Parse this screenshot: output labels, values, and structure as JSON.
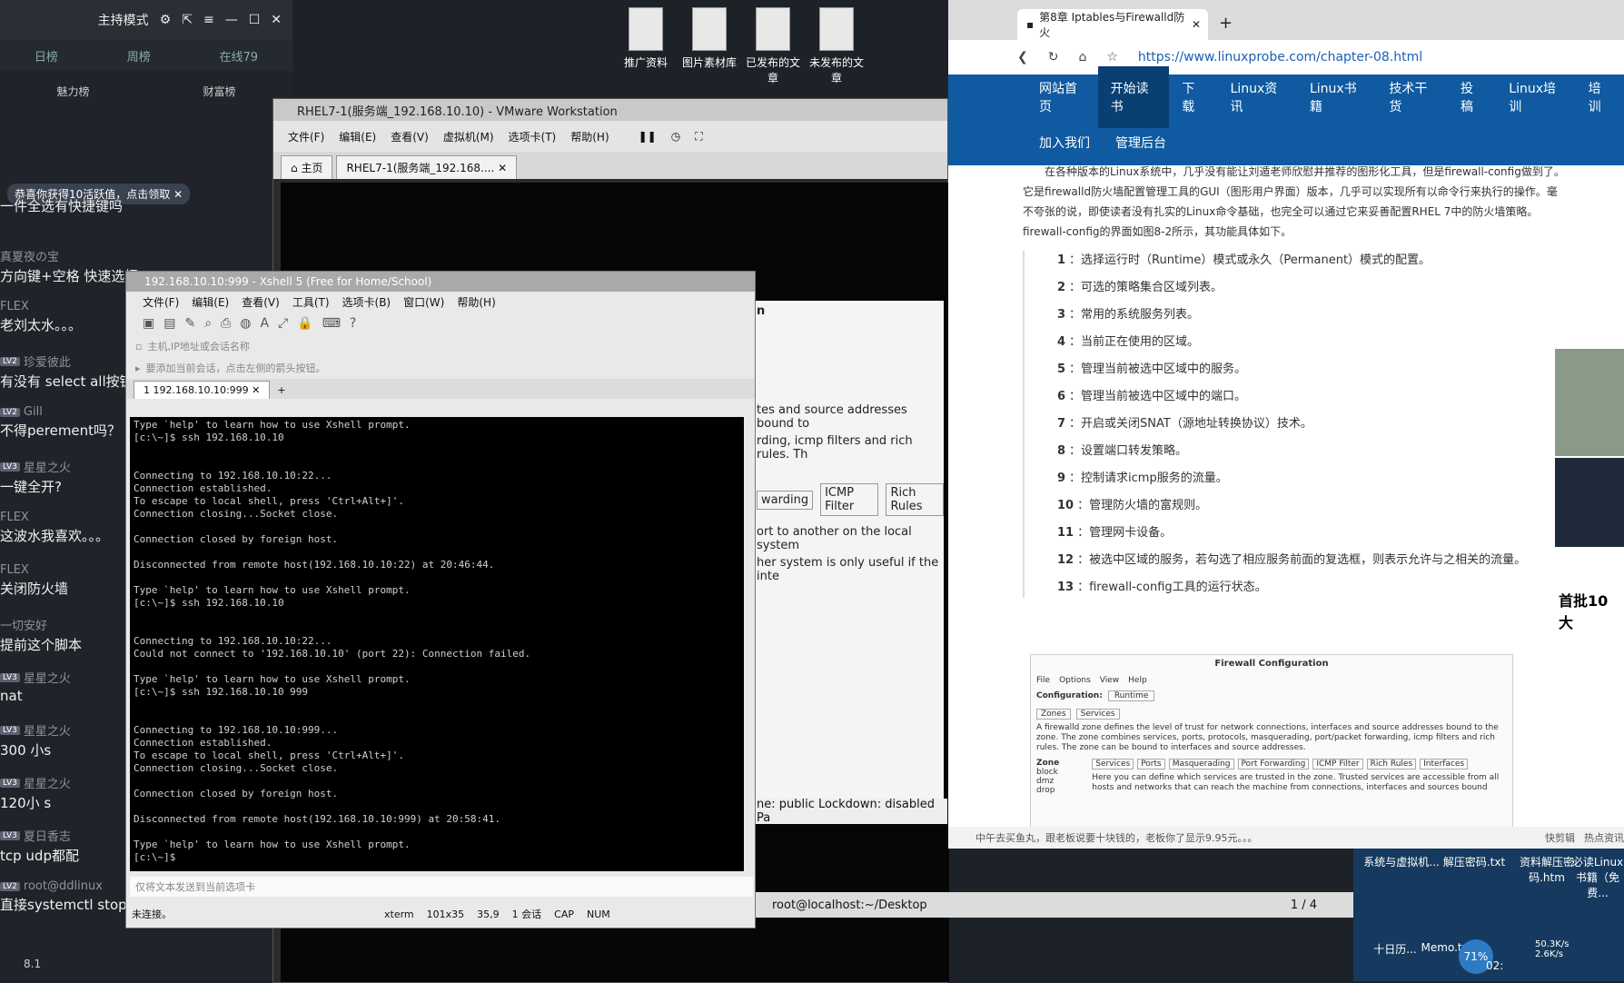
{
  "chat": {
    "window_title": "主持模式",
    "tabs": [
      "日榜",
      "周榜",
      "在线79"
    ],
    "ranks": [
      "魅力榜",
      "财富榜"
    ],
    "notice": "恭喜你获得10活跃值，点击领取",
    "messages": [
      {
        "user": "",
        "level": "",
        "text": "一件全选有快捷键吗"
      },
      {
        "user": "真夏夜の宝",
        "level": "",
        "text": "方向键+空格 快速选择"
      },
      {
        "user": "FLEX",
        "level": "",
        "text": "老刘太水。。。"
      },
      {
        "user": "珍爱彼此",
        "level": "LV2",
        "text": "有没有 select all按钮"
      },
      {
        "user": "Gill",
        "level": "LV2",
        "text": "不得perement吗？"
      },
      {
        "user": "星星之火",
        "level": "LV3",
        "text": "一键全开?"
      },
      {
        "user": "FLEX",
        "level": "",
        "text": "这波水我喜欢。。。"
      },
      {
        "user": "FLEX",
        "level": "",
        "text": "关闭防火墙"
      },
      {
        "user": "一切安好",
        "level": "",
        "text": "提前这个脚本"
      },
      {
        "user": "星星之火",
        "level": "LV3",
        "text": "nat"
      },
      {
        "user": "星星之火",
        "level": "LV3",
        "text": "300  小s"
      },
      {
        "user": "星星之火",
        "level": "LV3",
        "text": "120小 s"
      },
      {
        "user": "夏日香志",
        "level": "LV3",
        "text": "tcp udp都配"
      },
      {
        "user": "root@ddlinux",
        "level": "LV2",
        "text": "直接systemctl stop"
      }
    ],
    "bottom_value": "8.1"
  },
  "desktop": {
    "icons": [
      "推广资料",
      "图片素材库",
      "已发布的文章",
      "未发布的文章"
    ]
  },
  "vmware": {
    "title": "RHEL7-1(服务端_192.168.10.10) - VMware Workstation",
    "menu": [
      "文件(F)",
      "编辑(E)",
      "查看(V)",
      "虚拟机(M)",
      "选项卡(T)",
      "帮助(H)"
    ],
    "tabs": [
      "主页",
      "RHEL7-1(服务端_192.168...."
    ],
    "guest": {
      "frag_n": "n",
      "frag1": "tes and source addresses bound to",
      "frag2": "rding, icmp filters and rich rules. Th",
      "fw_tabs": [
        "warding",
        "ICMP Filter",
        "Rich Rules"
      ],
      "frag3": "ort to another on the local system",
      "frag4": "her system is only useful if the inte",
      "status": "ne: public  Lockdown: disabled  Pa"
    },
    "terminal_strip": {
      "title": "root@localhost:~/Desktop",
      "page": "1 / 4"
    }
  },
  "xshell": {
    "title": "192.168.10.10:999 - Xshell 5 (Free for Home/School)",
    "menu": [
      "文件(F)",
      "编辑(E)",
      "查看(V)",
      "工具(T)",
      "选项卡(B)",
      "窗口(W)",
      "帮助(H)"
    ],
    "address_placeholder": "主机,IP地址或会话名称",
    "hint": "要添加当前会话，点击左侧的箭头按钮。",
    "session_tab": "1 192.168.10.10:999",
    "terminal_lines": [
      "Type `help' to learn how to use Xshell prompt.",
      "[c:\\~]$ ssh 192.168.10.10",
      "",
      "",
      "Connecting to 192.168.10.10:22...",
      "Connection established.",
      "To escape to local shell, press 'Ctrl+Alt+]'.",
      "Connection closing...Socket close.",
      "",
      "Connection closed by foreign host.",
      "",
      "Disconnected from remote host(192.168.10.10:22) at 20:46:44.",
      "",
      "Type `help' to learn how to use Xshell prompt.",
      "[c:\\~]$ ssh 192.168.10.10",
      "",
      "",
      "Connecting to 192.168.10.10:22...",
      "Could not connect to '192.168.10.10' (port 22): Connection failed.",
      "",
      "Type `help' to learn how to use Xshell prompt.",
      "[c:\\~]$ ssh 192.168.10.10 999",
      "",
      "",
      "Connecting to 192.168.10.10:999...",
      "Connection established.",
      "To escape to local shell, press 'Ctrl+Alt+]'.",
      "Connection closing...Socket close.",
      "",
      "Connection closed by foreign host.",
      "",
      "Disconnected from remote host(192.168.10.10:999) at 20:58:41.",
      "",
      "Type `help' to learn how to use Xshell prompt.",
      "[c:\\~]$ "
    ],
    "send_placeholder": "仅将文本发送到当前选项卡",
    "status": {
      "left": "未连接。",
      "term": "xterm",
      "size": "101x35",
      "pos": "35,9",
      "sessions": "1 会话",
      "caps": "CAP",
      "num": "NUM"
    }
  },
  "browser": {
    "tab_title": "第8章 Iptables与Firewalld防火",
    "url": "https://www.linuxprobe.com/chapter-08.html",
    "nav_row1": [
      "网站首页",
      "开始读书",
      "下载",
      "Linux资讯",
      "Linux书籍",
      "技术干货",
      "投稿",
      "Linux培训",
      "培训"
    ],
    "nav_row2": [
      "加入我们",
      "管理后台"
    ],
    "intro": "在各种版本的Linux系统中，几乎没有能让刘遁老师欣慰并推荐的图形化工具，但是firewall-config做到了。它是firewalld防火墙配置管理工具的GUI（图形用户界面）版本，几乎可以实现所有以命令行来执行的操作。毫不夸张的说，即使读者没有扎实的Linux命令基础，也完全可以通过它来妥善配置RHEL 7中的防火墙策略。firewall-config的界面如图8-2所示，其功能具体如下。",
    "items": [
      {
        "n": "1",
        "t": "：选择运行时（Runtime）模式或永久（Permanent）模式的配置。"
      },
      {
        "n": "2",
        "t": "：可选的策略集合区域列表。"
      },
      {
        "n": "3",
        "t": "：常用的系统服务列表。"
      },
      {
        "n": "4",
        "t": "：当前正在使用的区域。"
      },
      {
        "n": "5",
        "t": "：管理当前被选中区域中的服务。"
      },
      {
        "n": "6",
        "t": "：管理当前被选中区域中的端口。"
      },
      {
        "n": "7",
        "t": "：开启或关闭SNAT（源地址转换协议）技术。"
      },
      {
        "n": "8",
        "t": "：设置端口转发策略。"
      },
      {
        "n": "9",
        "t": "：控制请求icmp服务的流量。"
      },
      {
        "n": "10",
        "t": "：管理防火墙的富规则。"
      },
      {
        "n": "11",
        "t": "：管理网卡设备。"
      },
      {
        "n": "12",
        "t": "：被选中区域的服务，若勾选了相应服务前面的复选框，则表示允许与之相关的流量。"
      },
      {
        "n": "13",
        "t": "：firewall-config工具的运行状态。"
      }
    ],
    "fw_figure": {
      "title": "Firewall Configuration",
      "menu": [
        "File",
        "Options",
        "View",
        "Help"
      ],
      "config_label": "Configuration:",
      "config_value": "Runtime",
      "tabs": [
        "Zones",
        "Services"
      ],
      "desc": "A firewalld zone defines the level of trust for network connections, interfaces and source addresses bound to the zone. The zone combines services, ports, protocols, masquerading, port/packet forwarding, icmp filters and rich rules. The zone can be bound to interfaces and source addresses.",
      "zone_label": "Zone",
      "zones": [
        "block",
        "dmz",
        "drop"
      ],
      "subtabs": [
        "Services",
        "Ports",
        "Masquerading",
        "Port Forwarding",
        "ICMP Filter",
        "Rich Rules",
        "Interfaces"
      ],
      "services_desc": "Here you can define which services are trusted in the zone. Trusted services are accessible from all hosts and networks that can reach the machine from connections, interfaces and sources bound"
    },
    "footer": "中午去买鱼丸，跟老板说要十块钱的，老板你了显示9.95元。。。",
    "footer_right": [
      "快剪辑",
      "热点资讯"
    ],
    "ad_text": "首批10大"
  },
  "taskbar": {
    "icons": [
      "系统与虚拟机...",
      "解压密码.txt",
      "资料解压密码.htm",
      "必读Linux书籍（免费...",
      "十日历...",
      "Memo.txt"
    ],
    "cpu_percent": "71%",
    "net_up": "50.3K/s",
    "net_down": "2.6K/s",
    "clock": "02:"
  },
  "colors": {
    "browser_nav": "#0f5aa0",
    "terminal_bg": "#000000",
    "taskbar": "#163a5f"
  }
}
